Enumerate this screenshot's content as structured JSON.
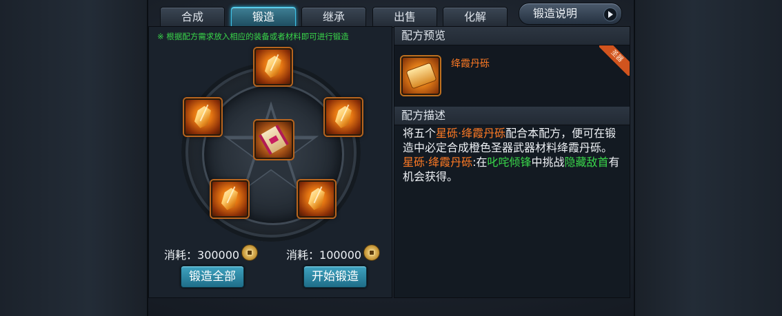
{
  "tabs": [
    {
      "label": "合成",
      "active": false
    },
    {
      "label": "锻造",
      "active": true
    },
    {
      "label": "继承",
      "active": false
    },
    {
      "label": "出售",
      "active": false
    },
    {
      "label": "化解",
      "active": false
    }
  ],
  "help_button": {
    "label": "锻造说明",
    "icon": "play-arrow-icon"
  },
  "forge": {
    "hint": "※ 根据配方需求放入相应的装备或者材料即可进行锻造",
    "center_item": {
      "icon": "recipe-scroll-icon"
    },
    "material_slots": [
      {
        "icon": "star-shard-icon"
      },
      {
        "icon": "star-shard-icon"
      },
      {
        "icon": "star-shard-icon"
      },
      {
        "icon": "star-shard-icon"
      },
      {
        "icon": "star-shard-icon"
      }
    ],
    "cost_all": {
      "label": "消耗：",
      "value": "300000",
      "icon": "copper-coin-icon"
    },
    "cost_single": {
      "label": "消耗：",
      "value": "100000",
      "icon": "copper-coin-icon"
    },
    "forge_all_button": "锻造全部",
    "start_forge_button": "开始锻造"
  },
  "recipe_preview": {
    "heading": "配方预览",
    "item_name": "绛霞丹砾",
    "item_icon": "recipe-scroll-icon",
    "ribbon": "圣器"
  },
  "recipe_description": {
    "heading": "配方描述",
    "line1": {
      "pre": "将五个",
      "material": "星砾·绛霞丹砾",
      "post": "配合本配方，便可在锻造中必定合成橙色圣器武器材料绛霞丹砾。"
    },
    "line2": {
      "material": "星砾·绛霞丹砾",
      "mid": ":在",
      "place": "叱咤倾锋",
      "mid2": "中挑战",
      "boss": "隐藏敌首",
      "post": "有机会获得。"
    }
  },
  "colors": {
    "accent_tab": "#3fc2e6",
    "hint_green": "#39d64a",
    "item_orange": "#ff7a24",
    "button_blue": "#2f8fae"
  }
}
